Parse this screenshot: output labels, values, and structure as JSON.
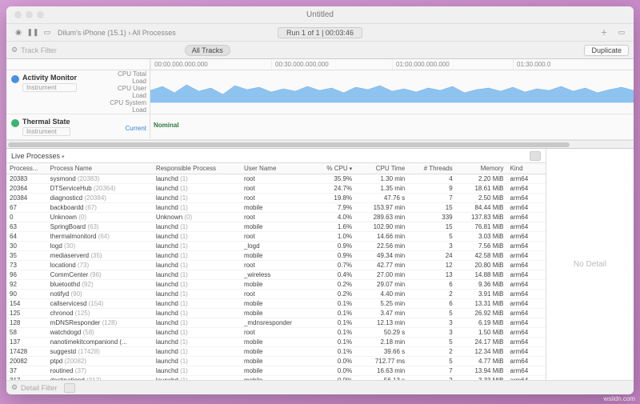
{
  "window": {
    "title": "Untitled"
  },
  "toolbar": {
    "breadcrumb": "Dilum's iPhone (15.1) › All Processes",
    "run_indicator": "Run 1 of 1  |  00:03:46",
    "duplicate": "Duplicate"
  },
  "filterbar": {
    "track_filter_placeholder": "Track Filter",
    "all_tracks": "All Tracks"
  },
  "timeline_ticks": [
    "00:00.000.000.000",
    "00:30.000.000.000",
    "01:00.000.000.000",
    "01:30.000.0"
  ],
  "tracks": {
    "activity": {
      "title": "Activity Monitor",
      "instrument": "Instrument",
      "lanes": [
        "CPU Total Load",
        "CPU User Load",
        "CPU System Load"
      ]
    },
    "thermal": {
      "title": "Thermal State",
      "instrument": "Instrument",
      "current": "Current",
      "nominal": "Nominal"
    }
  },
  "processes_header": "Live Processes",
  "columns": [
    "Process...",
    "Process Name",
    "Responsible Process",
    "User Name",
    "% CPU",
    "CPU Time",
    "# Threads",
    "Memory",
    "Kind"
  ],
  "rows": [
    {
      "pid": "20383",
      "name": "sysmond",
      "nsfx": "(20383)",
      "resp": "launchd",
      "rsfx": "(1)",
      "user": "root",
      "cpu": "35.9%",
      "time": "1.30 min",
      "threads": "4",
      "mem": "2.20 MiB",
      "kind": "arm64"
    },
    {
      "pid": "20364",
      "name": "DTServiceHub",
      "nsfx": "(20364)",
      "resp": "launchd",
      "rsfx": "(1)",
      "user": "root",
      "cpu": "24.7%",
      "time": "1.35 min",
      "threads": "9",
      "mem": "18.61 MiB",
      "kind": "arm64"
    },
    {
      "pid": "20384",
      "name": "diagnosticd",
      "nsfx": "(20384)",
      "resp": "launchd",
      "rsfx": "(1)",
      "user": "root",
      "cpu": "19.8%",
      "time": "47.76 s",
      "threads": "7",
      "mem": "2.50 MiB",
      "kind": "arm64"
    },
    {
      "pid": "67",
      "name": "backboardd",
      "nsfx": "(67)",
      "resp": "launchd",
      "rsfx": "(1)",
      "user": "mobile",
      "cpu": "7.9%",
      "time": "153.97 min",
      "threads": "15",
      "mem": "84.44 MiB",
      "kind": "arm64"
    },
    {
      "pid": "0",
      "name": "Unknown",
      "nsfx": "(0)",
      "resp": "Unknown",
      "rsfx": "(0)",
      "user": "root",
      "cpu": "4.0%",
      "time": "289.63 min",
      "threads": "339",
      "mem": "137.83 MiB",
      "kind": "arm64"
    },
    {
      "pid": "63",
      "name": "SpringBoard",
      "nsfx": "(63)",
      "resp": "launchd",
      "rsfx": "(1)",
      "user": "mobile",
      "cpu": "1.6%",
      "time": "102.90 min",
      "threads": "15",
      "mem": "76.81 MiB",
      "kind": "arm64"
    },
    {
      "pid": "64",
      "name": "thermalmonitord",
      "nsfx": "(64)",
      "resp": "launchd",
      "rsfx": "(1)",
      "user": "root",
      "cpu": "1.0%",
      "time": "14.66 min",
      "threads": "5",
      "mem": "3.03 MiB",
      "kind": "arm64"
    },
    {
      "pid": "30",
      "name": "logd",
      "nsfx": "(30)",
      "resp": "launchd",
      "rsfx": "(1)",
      "user": "_logd",
      "cpu": "0.9%",
      "time": "22.56 min",
      "threads": "3",
      "mem": "7.56 MiB",
      "kind": "arm64"
    },
    {
      "pid": "35",
      "name": "mediaserverd",
      "nsfx": "(35)",
      "resp": "launchd",
      "rsfx": "(1)",
      "user": "mobile",
      "cpu": "0.9%",
      "time": "49.34 min",
      "threads": "24",
      "mem": "42.58 MiB",
      "kind": "arm64"
    },
    {
      "pid": "73",
      "name": "locationd",
      "nsfx": "(73)",
      "resp": "launchd",
      "rsfx": "(1)",
      "user": "root",
      "cpu": "0.7%",
      "time": "42.77 min",
      "threads": "12",
      "mem": "20.80 MiB",
      "kind": "arm64"
    },
    {
      "pid": "96",
      "name": "CommCenter",
      "nsfx": "(96)",
      "resp": "launchd",
      "rsfx": "(1)",
      "user": "_wireless",
      "cpu": "0.4%",
      "time": "27.00 min",
      "threads": "13",
      "mem": "14.88 MiB",
      "kind": "arm64"
    },
    {
      "pid": "92",
      "name": "bluetoothd",
      "nsfx": "(92)",
      "resp": "launchd",
      "rsfx": "(1)",
      "user": "mobile",
      "cpu": "0.2%",
      "time": "29.07 min",
      "threads": "6",
      "mem": "9.36 MiB",
      "kind": "arm64"
    },
    {
      "pid": "90",
      "name": "notifyd",
      "nsfx": "(90)",
      "resp": "launchd",
      "rsfx": "(1)",
      "user": "root",
      "cpu": "0.2%",
      "time": "4.40 min",
      "threads": "2",
      "mem": "3.91 MiB",
      "kind": "arm64"
    },
    {
      "pid": "154",
      "name": "callservicesd",
      "nsfx": "(154)",
      "resp": "launchd",
      "rsfx": "(1)",
      "user": "mobile",
      "cpu": "0.1%",
      "time": "5.25 min",
      "threads": "6",
      "mem": "13.31 MiB",
      "kind": "arm64"
    },
    {
      "pid": "125",
      "name": "chronod",
      "nsfx": "(125)",
      "resp": "launchd",
      "rsfx": "(1)",
      "user": "mobile",
      "cpu": "0.1%",
      "time": "3.47 min",
      "threads": "5",
      "mem": "26.92 MiB",
      "kind": "arm64"
    },
    {
      "pid": "128",
      "name": "mDNSResponder",
      "nsfx": "(128)",
      "resp": "launchd",
      "rsfx": "(1)",
      "user": "_mdnsresponder",
      "cpu": "0.1%",
      "time": "12.13 min",
      "threads": "3",
      "mem": "6.19 MiB",
      "kind": "arm64"
    },
    {
      "pid": "58",
      "name": "watchdogd",
      "nsfx": "(58)",
      "resp": "launchd",
      "rsfx": "(1)",
      "user": "root",
      "cpu": "0.1%",
      "time": "50.29 s",
      "threads": "3",
      "mem": "1.50 MiB",
      "kind": "arm64"
    },
    {
      "pid": "137",
      "name": "nanotimekitcompaniond (...",
      "nsfx": "",
      "resp": "launchd",
      "rsfx": "(1)",
      "user": "mobile",
      "cpu": "0.1%",
      "time": "2.18 min",
      "threads": "5",
      "mem": "24.17 MiB",
      "kind": "arm64"
    },
    {
      "pid": "17428",
      "name": "suggestd",
      "nsfx": "(17428)",
      "resp": "launchd",
      "rsfx": "(1)",
      "user": "mobile",
      "cpu": "0.1%",
      "time": "39.66 s",
      "threads": "2",
      "mem": "12.34 MiB",
      "kind": "arm64"
    },
    {
      "pid": "20082",
      "name": "ptpd",
      "nsfx": "(20082)",
      "resp": "launchd",
      "rsfx": "(1)",
      "user": "mobile",
      "cpu": "0.0%",
      "time": "712.77 ms",
      "threads": "5",
      "mem": "4.77 MiB",
      "kind": "arm64"
    },
    {
      "pid": "37",
      "name": "routined",
      "nsfx": "(37)",
      "resp": "launchd",
      "rsfx": "(1)",
      "user": "mobile",
      "cpu": "0.0%",
      "time": "16.63 min",
      "threads": "7",
      "mem": "13.94 MiB",
      "kind": "arm64"
    },
    {
      "pid": "317",
      "name": "destinationd",
      "nsfx": "(317)",
      "resp": "launchd",
      "rsfx": "(1)",
      "user": "mobile",
      "cpu": "0.0%",
      "time": "56.13 s",
      "threads": "2",
      "mem": "3.33 MiB",
      "kind": "arm64"
    }
  ],
  "no_detail": "No Detail",
  "statusbar": {
    "detail_filter": "Detail Filter"
  },
  "watermark": "wsiidn.com"
}
